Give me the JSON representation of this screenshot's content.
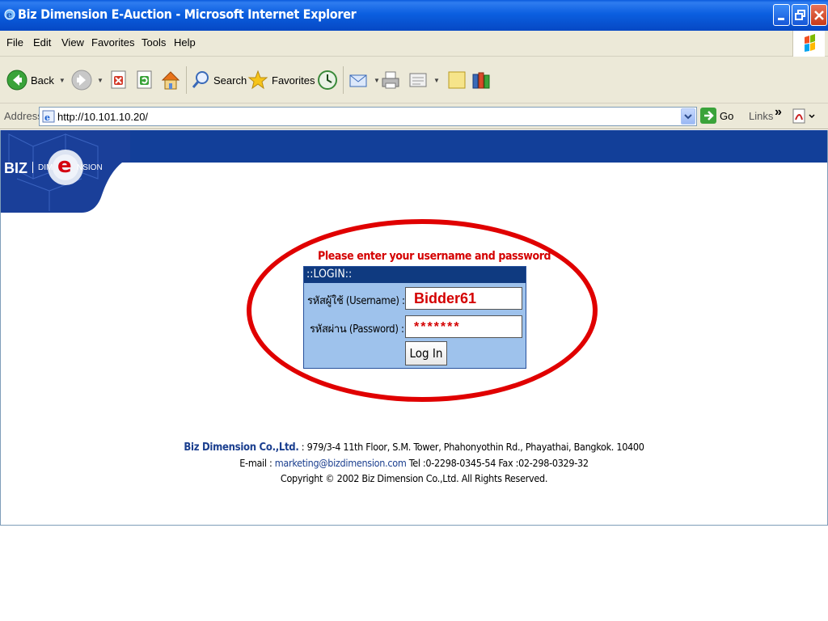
{
  "window": {
    "title": "Biz Dimension E-Auction - Microsoft Internet Explorer"
  },
  "menu": [
    "File",
    "Edit",
    "View",
    "Favorites",
    "Tools",
    "Help"
  ],
  "toolbar": {
    "back_label": "Back",
    "search_label": "Search",
    "favorites_label": "Favorites"
  },
  "address": {
    "label": "Address",
    "url": "http://10.101.10.20/",
    "go_label": "Go",
    "links_label": "Links"
  },
  "page": {
    "logo_text_biz": "BIZ",
    "logo_text_dim": "DIM",
    "logo_text_e": "e",
    "logo_text_nsion": "NSION",
    "prompt": "Please enter your username and password",
    "login_header": "::LOGIN::",
    "username_label": "รหัสผู้ใช้ (Username) :",
    "username_value": "Bidder61",
    "password_label": "รหัสผ่าน (Password) :",
    "password_value": "*******",
    "login_button": "Log In"
  },
  "footer": {
    "company": "Biz Dimension Co.,Ltd.",
    "address": " : 979/3-4 11th Floor, S.M. Tower, Phahonyothin Rd., Phayathai, Bangkok. 10400",
    "email_prefix": "E-mail : ",
    "email": "marketing@bizdimension.com",
    "contact": " Tel :0-2298-0345-54 Fax :02-298-0329-32",
    "copyright": "Copyright © 2002 Biz Dimension Co.,Ltd. All Rights Reserved."
  },
  "colors": {
    "titlebar": "#0b5fe0",
    "header_band": "#123f99",
    "login_panel": "#9ec2ec",
    "highlight_ellipse": "#e00000"
  }
}
